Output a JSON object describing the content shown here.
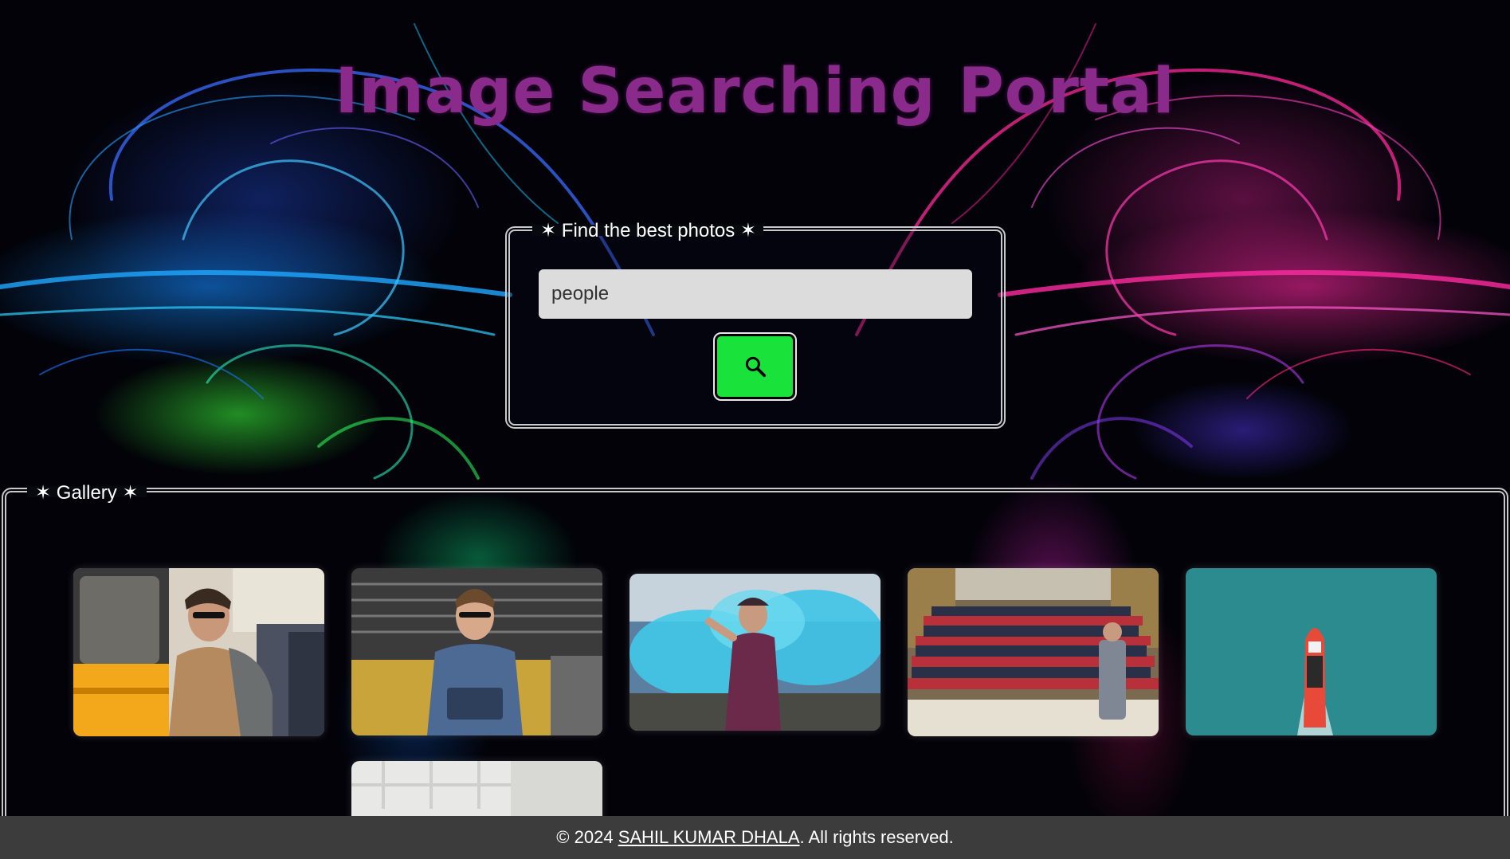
{
  "header": {
    "title": "Image Searching Portal"
  },
  "search": {
    "legend": "✶ Find the best photos ✶",
    "value": "people",
    "button_icon": "search-icon"
  },
  "gallery": {
    "legend": "✶ Gallery ✶",
    "photos": [
      {
        "subject": "commuter-train"
      },
      {
        "subject": "man-reading"
      },
      {
        "subject": "blue-smoke-woman"
      },
      {
        "subject": "lecture-hall"
      },
      {
        "subject": "boat-aerial"
      },
      {
        "subject": "white-interior"
      }
    ]
  },
  "footer": {
    "prefix": "© 2024 ",
    "author": "SAHIL KUMAR DHALA",
    "suffix": ". All rights reserved."
  },
  "colors": {
    "title": "#8a2a8a",
    "search_button": "#19e23b",
    "input_bg": "#dcdcdc",
    "footer_bg": "#3c3c3c"
  }
}
